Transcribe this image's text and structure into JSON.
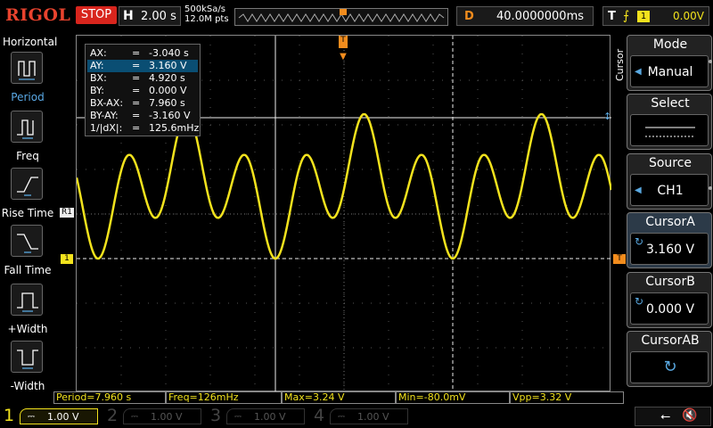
{
  "top": {
    "logo": "RIGOL",
    "run_state": "STOP",
    "timebase_label": "H",
    "timebase_value": "2.00 s",
    "sample_rate": "500kSa/s",
    "memory_depth": "12.0M pts",
    "delay_label": "D",
    "delay_value": "40.0000000ms",
    "trigger_label": "T",
    "trigger_edge": "⨍",
    "trigger_source": "1",
    "trigger_level": "0.00V"
  },
  "left_menu": {
    "title": "Horizontal",
    "items": [
      {
        "label": "Period",
        "icon": "period-icon"
      },
      {
        "label": "Freq",
        "icon": "freq-icon"
      },
      {
        "label": "Rise Time",
        "icon": "rise-time-icon"
      },
      {
        "label": "Fall Time",
        "icon": "fall-time-icon"
      },
      {
        "label": "+Width",
        "icon": "pos-width-icon"
      },
      {
        "label": "-Width",
        "icon": "neg-width-icon"
      }
    ]
  },
  "cursor_table": {
    "rows": [
      {
        "key": "AX:",
        "eq": "=",
        "val": "-3.040 s"
      },
      {
        "key": "AY:",
        "eq": "=",
        "val": "3.160 V"
      },
      {
        "key": "BX:",
        "eq": "=",
        "val": "4.920 s"
      },
      {
        "key": "BY:",
        "eq": "=",
        "val": "0.000 V"
      },
      {
        "key": "BX-AX:",
        "eq": "=",
        "val": "7.960 s"
      },
      {
        "key": "BY-AY:",
        "eq": "=",
        "val": "-3.160 V"
      },
      {
        "key": "1/|dX|:",
        "eq": "=",
        "val": "125.6mHz"
      }
    ]
  },
  "markers": {
    "trigger_position": "T",
    "ref": "R1",
    "ch1": "1",
    "trigger_level": "T",
    "cursor_b": "↕"
  },
  "measurements": [
    "Period=7.960 s",
    "Freq=126mHz",
    "Max=3.24 V",
    "Min=-80.0mV",
    "Vpp=3.32 V"
  ],
  "channels": [
    {
      "num": "1",
      "coupling": "⎓",
      "scale": "1.00 V"
    },
    {
      "num": "2",
      "coupling": "⎓",
      "scale": "1.00 V"
    },
    {
      "num": "3",
      "coupling": "⎓",
      "scale": "1.00 V"
    },
    {
      "num": "4",
      "coupling": "⎓",
      "scale": "1.00 V"
    }
  ],
  "tray": {
    "usb": "⭠",
    "sound": "🔇"
  },
  "right_menu": {
    "side_label": "Cursor",
    "blocks": [
      {
        "title": "Mode",
        "value": "Manual",
        "icon": "left-arrow-icon"
      },
      {
        "title": "Select",
        "value": "",
        "icon": ""
      },
      {
        "title": "Source",
        "value": "CH1",
        "icon": "left-arrow-icon"
      },
      {
        "title": "CursorA",
        "value": "3.160 V",
        "icon": "knob-icon"
      },
      {
        "title": "CursorB",
        "value": "0.000 V",
        "icon": "knob-icon"
      },
      {
        "title": "CursorAB",
        "value": "",
        "icon": "knob-icon"
      }
    ]
  },
  "colors": {
    "ch1": "#f2e21d",
    "trigger": "#f28c1d",
    "stop": "#d8251d",
    "cursor": "#59a8e0"
  }
}
